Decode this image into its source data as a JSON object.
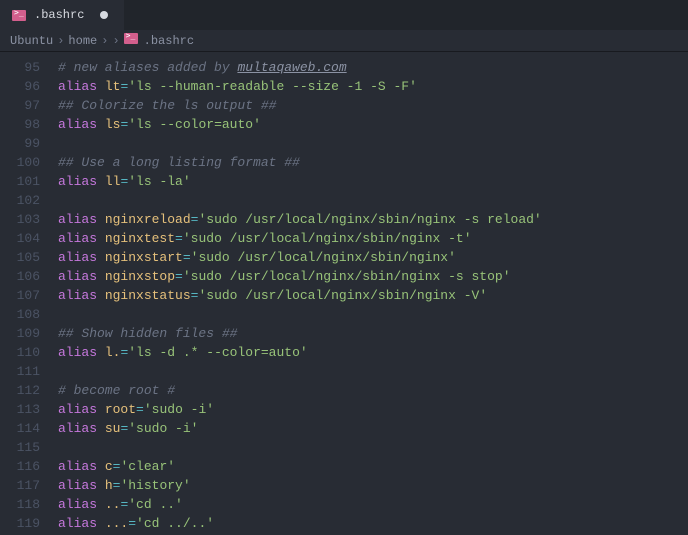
{
  "tab": {
    "filename": ".bashrc",
    "dirty": true
  },
  "breadcrumbs": {
    "p0": "Ubuntu",
    "p1": "home",
    "p2": ".bashrc"
  },
  "lines": {
    "start": 95,
    "l95": {
      "comment_a": "# new aliases added by ",
      "link": "multaqaweb.com"
    },
    "l96": {
      "name": "lt",
      "value": "'ls --human-readable --size -1 -S -F'"
    },
    "l97": {
      "comment": "## Colorize the ls output ##"
    },
    "l98": {
      "name": "ls",
      "value": "'ls --color=auto'"
    },
    "l99": {},
    "l100": {
      "comment": "## Use a long listing format ##"
    },
    "l101": {
      "name": "ll",
      "value": "'ls -la'"
    },
    "l102": {},
    "l103": {
      "name": "nginxreload",
      "value": "'sudo /usr/local/nginx/sbin/nginx -s reload'"
    },
    "l104": {
      "name": "nginxtest",
      "value": "'sudo /usr/local/nginx/sbin/nginx -t'"
    },
    "l105": {
      "name": "nginxstart",
      "value": "'sudo /usr/local/nginx/sbin/nginx'"
    },
    "l106": {
      "name": "nginxstop",
      "value": "'sudo /usr/local/nginx/sbin/nginx -s stop'"
    },
    "l107": {
      "name": "nginxstatus",
      "value": "'sudo /usr/local/nginx/sbin/nginx -V'"
    },
    "l108": {},
    "l109": {
      "comment": "## Show hidden files ##"
    },
    "l110": {
      "name": "l.",
      "value": "'ls -d .* --color=auto'"
    },
    "l111": {},
    "l112": {
      "comment": "# become root #"
    },
    "l113": {
      "name": "root",
      "value": "'sudo -i'"
    },
    "l114": {
      "name": "su",
      "value": "'sudo -i'"
    },
    "l115": {},
    "l116": {
      "name": "c",
      "value": "'clear'"
    },
    "l117": {
      "name": "h",
      "value": "'history'"
    },
    "l118": {
      "name": "..",
      "value": "'cd ..'"
    },
    "l119": {
      "name": "...",
      "value": "'cd ../..'"
    }
  },
  "alias_kw": "alias",
  "eq": "="
}
